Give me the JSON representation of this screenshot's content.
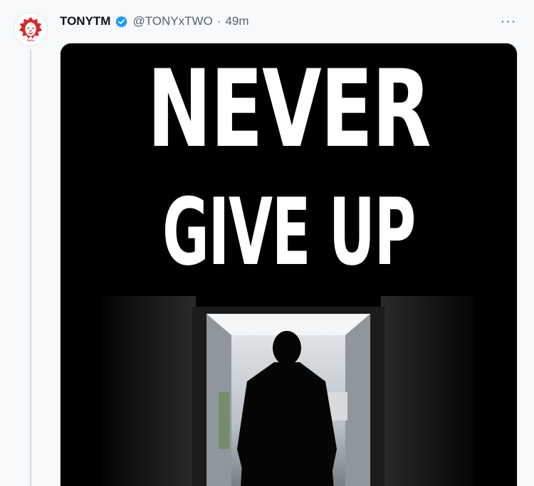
{
  "tweet": {
    "display_name": "TONYTM",
    "handle": "@TONYxTWO",
    "separator": "·",
    "time": "49m",
    "more_label": "···"
  },
  "media": {
    "headline_line1": "NEVER",
    "headline_line2": "GIVE UP"
  },
  "colors": {
    "background": "#f7f9fa",
    "text_primary": "#0f1419",
    "text_secondary": "#536471",
    "verified": "#1d9bf0",
    "media_bg": "#000000"
  },
  "icons": {
    "avatar": "lion-logo-avatar",
    "verified": "verified-badge-icon",
    "more": "more-options-icon"
  }
}
